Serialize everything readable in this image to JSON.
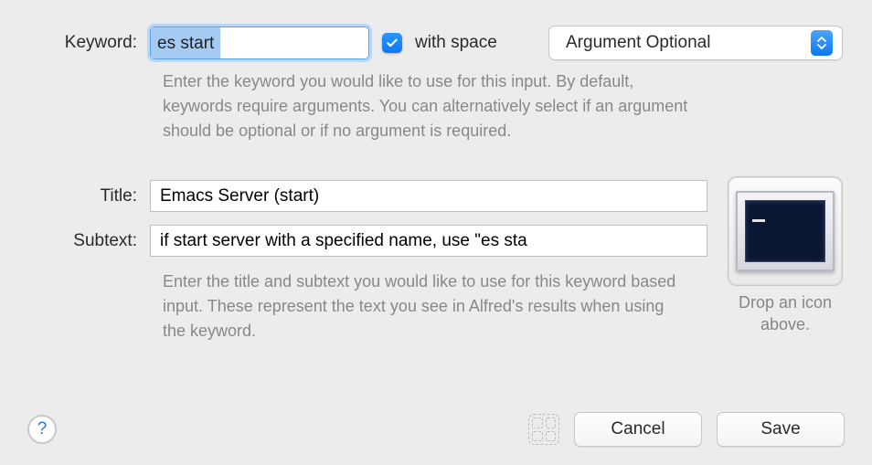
{
  "labels": {
    "keyword": "Keyword:",
    "title": "Title:",
    "subtext": "Subtext:"
  },
  "keyword": {
    "value": "es start"
  },
  "with_space": {
    "checked": true,
    "label": "with space"
  },
  "argument": {
    "selected": "Argument Optional"
  },
  "notes": {
    "keyword": "Enter the keyword you would like to use for this input. By default, keywords require arguments. You can alternatively select if an argument should be optional or if no argument is required.",
    "title_sub": "Enter the title and subtext you would like to use for this keyword based input. These represent the text you see in Alfred's results when using the keyword."
  },
  "title_field": {
    "value": "Emacs Server (start)"
  },
  "subtext_field": {
    "value": "if start server with a specified name, use \"es sta"
  },
  "icon_well": {
    "caption": "Drop an icon above."
  },
  "buttons": {
    "cancel": "Cancel",
    "save": "Save"
  },
  "help": {
    "glyph": "?"
  }
}
